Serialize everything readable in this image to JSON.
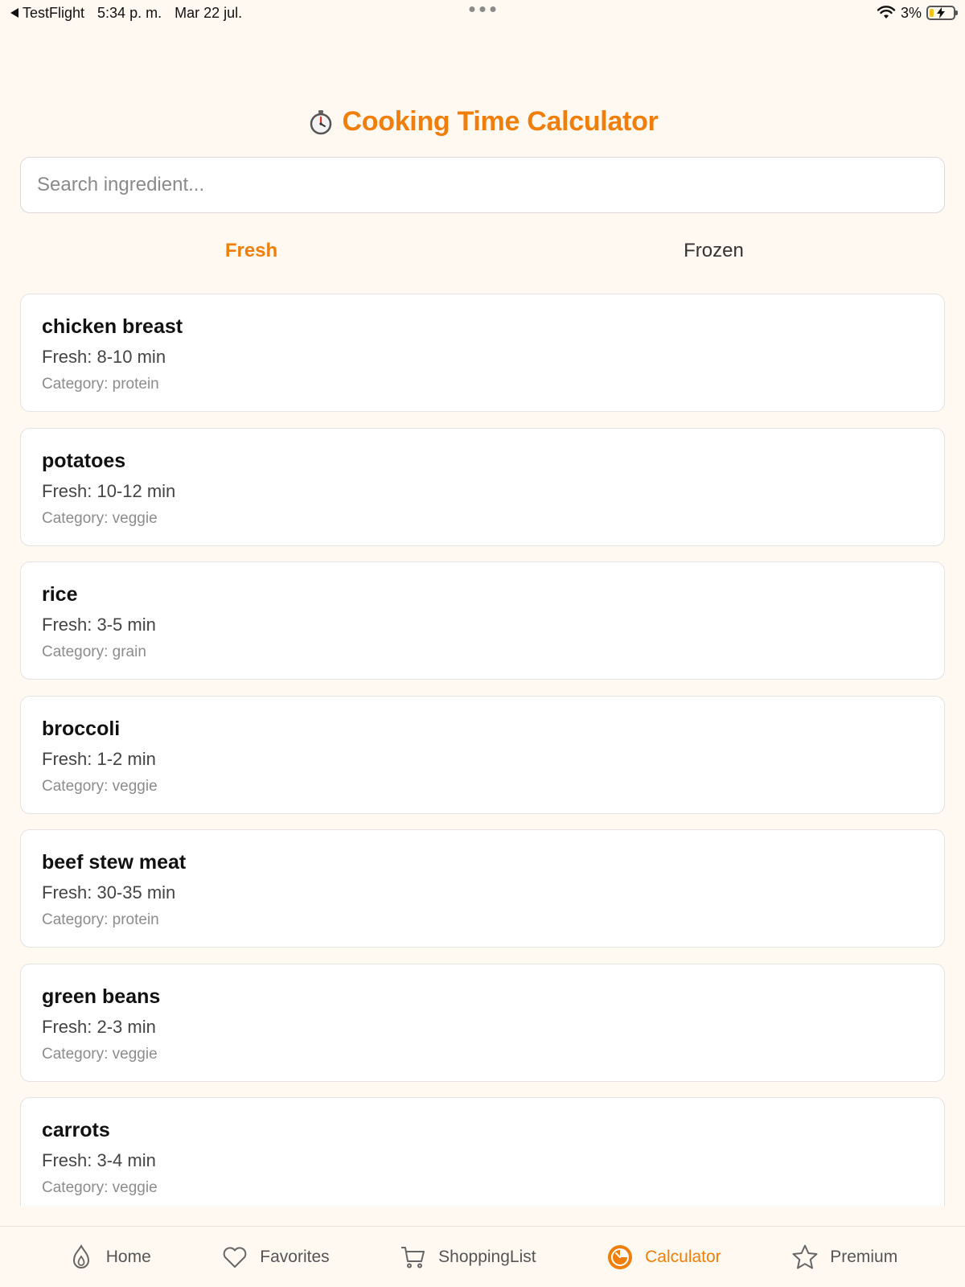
{
  "status_bar": {
    "back_app": "TestFlight",
    "time": "5:34 p. m.",
    "date": "Mar 22 jul.",
    "battery": "3%"
  },
  "header": {
    "title": "Cooking Time Calculator",
    "icon": "stopwatch-icon"
  },
  "search": {
    "placeholder": "Search ingredient...",
    "value": ""
  },
  "tabs": [
    {
      "label": "Fresh",
      "active": true
    },
    {
      "label": "Frozen",
      "active": false
    }
  ],
  "items": [
    {
      "name": "chicken breast",
      "time": "Fresh: 8-10 min",
      "category": "Category: protein"
    },
    {
      "name": "potatoes",
      "time": "Fresh: 10-12 min",
      "category": "Category: veggie"
    },
    {
      "name": "rice",
      "time": "Fresh: 3-5 min",
      "category": "Category: grain"
    },
    {
      "name": "broccoli",
      "time": "Fresh: 1-2 min",
      "category": "Category: veggie"
    },
    {
      "name": "beef stew meat",
      "time": "Fresh: 30-35 min",
      "category": "Category: protein"
    },
    {
      "name": "green beans",
      "time": "Fresh: 2-3 min",
      "category": "Category: veggie"
    },
    {
      "name": "carrots",
      "time": "Fresh: 3-4 min",
      "category": "Category: veggie"
    }
  ],
  "nav": [
    {
      "label": "Home",
      "icon": "flame-icon",
      "active": false
    },
    {
      "label": "Favorites",
      "icon": "heart-icon",
      "active": false
    },
    {
      "label": "ShoppingList",
      "icon": "cart-icon",
      "active": false
    },
    {
      "label": "Calculator",
      "icon": "timer-icon",
      "active": true
    },
    {
      "label": "Premium",
      "icon": "star-icon",
      "active": false
    }
  ],
  "colors": {
    "accent": "#F07E0A",
    "background": "#FFF9F1",
    "card": "#FFFFFF"
  }
}
